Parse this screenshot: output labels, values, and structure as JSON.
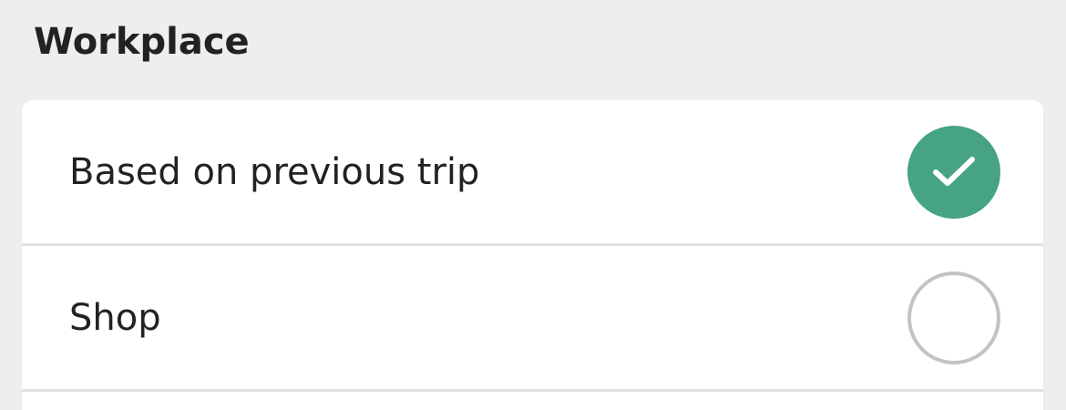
{
  "section": {
    "title": "Workplace"
  },
  "options": [
    {
      "label": "Based on previous trip",
      "selected": true,
      "icon": "checkmark-icon"
    },
    {
      "label": "Shop",
      "selected": false,
      "icon": ""
    }
  ],
  "colors": {
    "background": "#eeeeee",
    "card": "#ffffff",
    "accent": "#46a383",
    "radio_border": "#c3c3c3",
    "divider": "#e2e2e2"
  }
}
